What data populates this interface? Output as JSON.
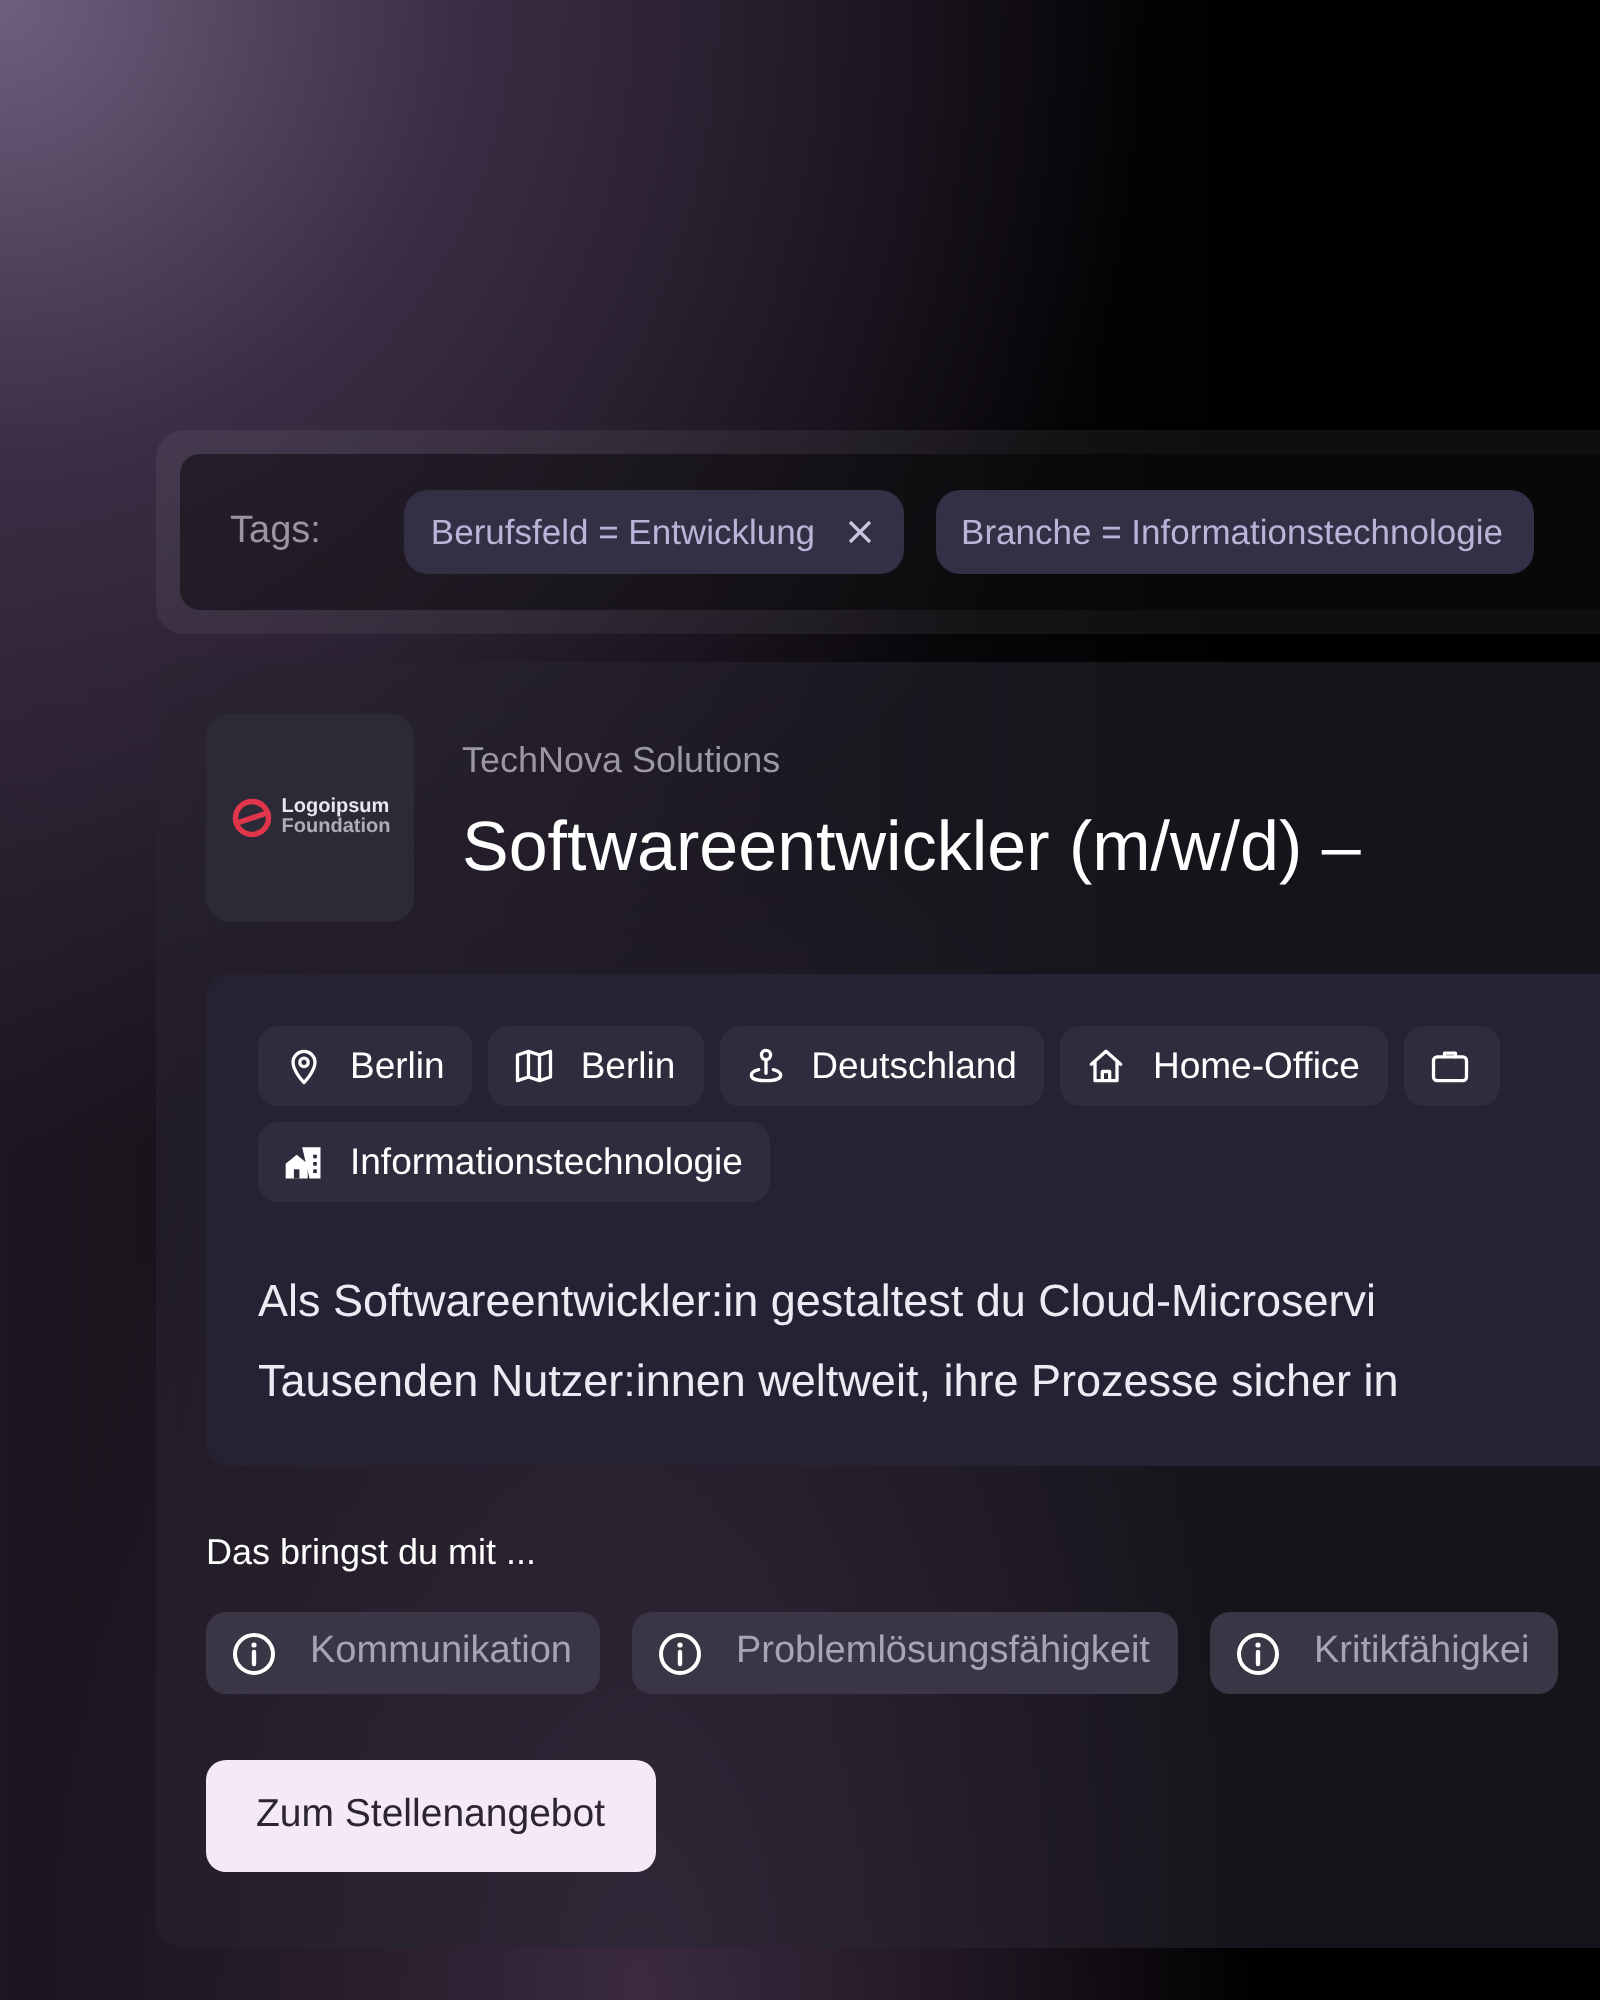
{
  "filter_bar": {
    "label": "Tags:",
    "tags": [
      {
        "text": "Berufsfeld = Entwicklung",
        "removable": true
      },
      {
        "text": "Branche = Informationstechnologie",
        "removable": false
      }
    ]
  },
  "job": {
    "company": "TechNova Solutions",
    "logo_text": [
      "Logoipsum",
      "Foundation"
    ],
    "title": "Softwareentwickler (m/w/d) –",
    "attributes": [
      {
        "kind": "location",
        "label": "Berlin"
      },
      {
        "kind": "region",
        "label": "Berlin"
      },
      {
        "kind": "country",
        "label": "Deutschland"
      },
      {
        "kind": "workplace",
        "label": "Home-Office"
      },
      {
        "kind": "employment"
      },
      {
        "kind": "industry",
        "label": "Informationstechnologie"
      }
    ],
    "description": [
      "Als Softwareentwickler:in gestaltest du Cloud-Microservi",
      "Tausenden Nutzer:innen weltweit, ihre Prozesse sicher in"
    ],
    "skills_heading": "Das bringst du mit ...",
    "skills": [
      "Kommunikation",
      "Problemlösungsfähigkeit",
      "Kritikfähigkei"
    ],
    "button": "Zum Stellenangebot"
  }
}
